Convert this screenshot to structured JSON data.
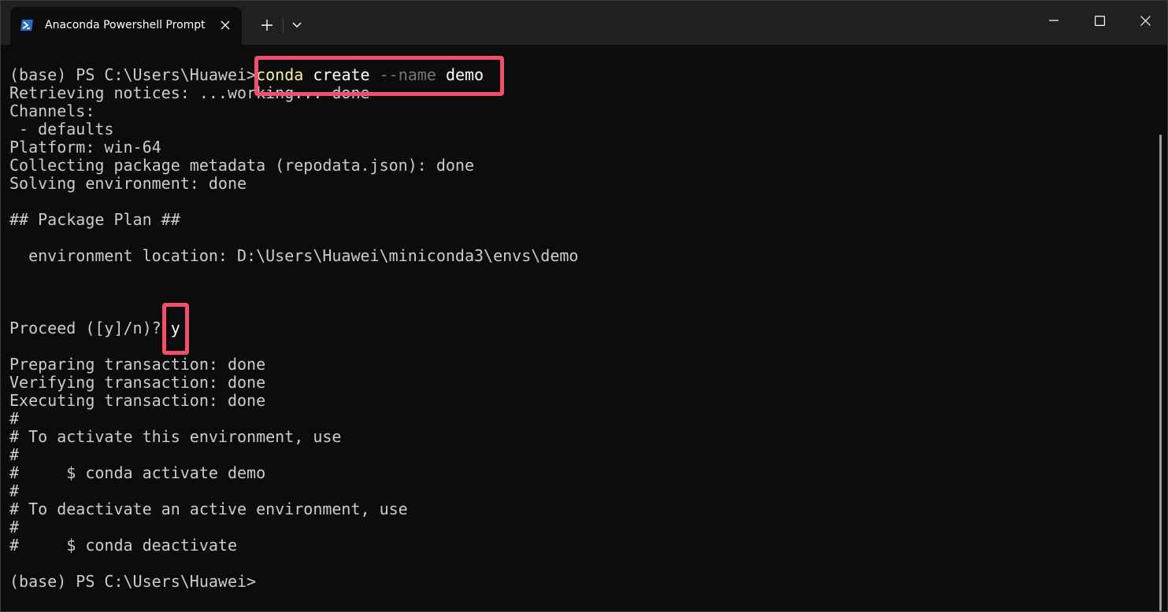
{
  "window": {
    "tab_title": "Anaconda Powershell Prompt",
    "icons": {
      "tab_icon": "powershell-icon",
      "close": "close-icon",
      "new_tab": "plus-icon",
      "dropdown": "chevron-down-icon",
      "minimize": "minimize-icon",
      "maximize": "maximize-icon",
      "window_close": "close-icon"
    }
  },
  "colors": {
    "terminal_bg": "#0c0c0c",
    "text": "#cccccc",
    "command_keyword": "#f9f1a5",
    "parameter": "#767676",
    "highlight_box": "#f0506e",
    "powershell_blue": "#2b6cc4"
  },
  "terminal": {
    "prompt": "(base) PS C:\\Users\\Huawei>",
    "command": {
      "keyword": "conda",
      "arg1": "create",
      "flag": "--name",
      "arg2": "demo"
    },
    "lines": [
      "Retrieving notices: ...working... done",
      "Channels:",
      " - defaults",
      "Platform: win-64",
      "Collecting package metadata (repodata.json): done",
      "Solving environment: done",
      "",
      "## Package Plan ##",
      "",
      "  environment location: D:\\Users\\Huawei\\miniconda3\\envs\\demo",
      "",
      "",
      "",
      "Proceed ([y]/n)? ",
      "",
      "Preparing transaction: done",
      "Verifying transaction: done",
      "Executing transaction: done",
      "#",
      "# To activate this environment, use",
      "#",
      "#     $ conda activate demo",
      "#",
      "# To deactivate an active environment, use",
      "#",
      "#     $ conda deactivate",
      "",
      "(base) PS C:\\Users\\Huawei>"
    ],
    "proceed_answer": "y"
  }
}
